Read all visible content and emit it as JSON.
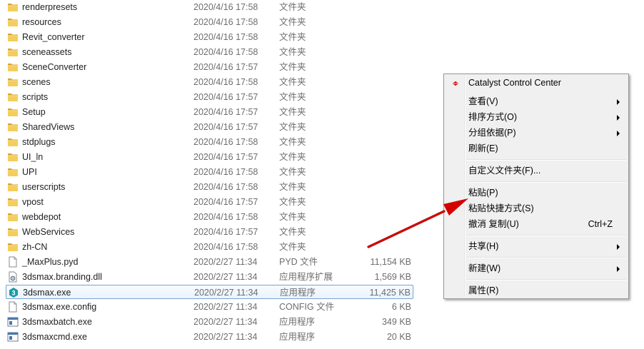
{
  "files": [
    {
      "name": "renderpresets",
      "date": "2020/4/16 17:58",
      "type": "文件夹",
      "size": "",
      "icon": "folder-icon"
    },
    {
      "name": "resources",
      "date": "2020/4/16 17:58",
      "type": "文件夹",
      "size": "",
      "icon": "folder-icon"
    },
    {
      "name": "Revit_converter",
      "date": "2020/4/16 17:58",
      "type": "文件夹",
      "size": "",
      "icon": "folder-icon"
    },
    {
      "name": "sceneassets",
      "date": "2020/4/16 17:58",
      "type": "文件夹",
      "size": "",
      "icon": "folder-icon"
    },
    {
      "name": "SceneConverter",
      "date": "2020/4/16 17:57",
      "type": "文件夹",
      "size": "",
      "icon": "folder-icon"
    },
    {
      "name": "scenes",
      "date": "2020/4/16 17:58",
      "type": "文件夹",
      "size": "",
      "icon": "folder-icon"
    },
    {
      "name": "scripts",
      "date": "2020/4/16 17:57",
      "type": "文件夹",
      "size": "",
      "icon": "folder-icon"
    },
    {
      "name": "Setup",
      "date": "2020/4/16 17:57",
      "type": "文件夹",
      "size": "",
      "icon": "folder-icon"
    },
    {
      "name": "SharedViews",
      "date": "2020/4/16 17:57",
      "type": "文件夹",
      "size": "",
      "icon": "folder-icon"
    },
    {
      "name": "stdplugs",
      "date": "2020/4/16 17:58",
      "type": "文件夹",
      "size": "",
      "icon": "folder-icon"
    },
    {
      "name": "UI_ln",
      "date": "2020/4/16 17:57",
      "type": "文件夹",
      "size": "",
      "icon": "folder-icon"
    },
    {
      "name": "UPI",
      "date": "2020/4/16 17:58",
      "type": "文件夹",
      "size": "",
      "icon": "folder-icon"
    },
    {
      "name": "userscripts",
      "date": "2020/4/16 17:58",
      "type": "文件夹",
      "size": "",
      "icon": "folder-icon"
    },
    {
      "name": "vpost",
      "date": "2020/4/16 17:57",
      "type": "文件夹",
      "size": "",
      "icon": "folder-icon"
    },
    {
      "name": "webdepot",
      "date": "2020/4/16 17:58",
      "type": "文件夹",
      "size": "",
      "icon": "folder-icon"
    },
    {
      "name": "WebServices",
      "date": "2020/4/16 17:57",
      "type": "文件夹",
      "size": "",
      "icon": "folder-icon"
    },
    {
      "name": "zh-CN",
      "date": "2020/4/16 17:58",
      "type": "文件夹",
      "size": "",
      "icon": "folder-icon"
    },
    {
      "name": "_MaxPlus.pyd",
      "date": "2020/2/27 11:34",
      "type": "PYD 文件",
      "size": "11,154 KB",
      "icon": "document-icon"
    },
    {
      "name": "3dsmax.branding.dll",
      "date": "2020/2/27 11:34",
      "type": "应用程序扩展",
      "size": "1,569 KB",
      "icon": "dll-gear-icon"
    },
    {
      "name": "3dsmax.exe",
      "date": "2020/2/27 11:34",
      "type": "应用程序",
      "size": "11,425 KB",
      "icon": "3dsmax-app-icon",
      "selected": true
    },
    {
      "name": "3dsmax.exe.config",
      "date": "2020/2/27 11:34",
      "type": "CONFIG 文件",
      "size": "6 KB",
      "icon": "document-icon"
    },
    {
      "name": "3dsmaxbatch.exe",
      "date": "2020/2/27 11:34",
      "type": "应用程序",
      "size": "349 KB",
      "icon": "console-app-icon"
    },
    {
      "name": "3dsmaxcmd.exe",
      "date": "2020/2/27 11:34",
      "type": "应用程序",
      "size": "20 KB",
      "icon": "console-app-icon"
    }
  ],
  "context_menu": {
    "items": [
      {
        "label": "Catalyst Control Center",
        "icon": "catalyst-icon"
      },
      {
        "label": "查看(V)",
        "submenu": true
      },
      {
        "label": "排序方式(O)",
        "submenu": true
      },
      {
        "label": "分组依据(P)",
        "submenu": true
      },
      {
        "label": "刷新(E)"
      },
      {
        "separator": true
      },
      {
        "label": "自定义文件夹(F)..."
      },
      {
        "separator": true
      },
      {
        "label": "粘贴(P)"
      },
      {
        "label": "粘贴快捷方式(S)"
      },
      {
        "label": "撤消 复制(U)",
        "shortcut": "Ctrl+Z"
      },
      {
        "separator": true
      },
      {
        "label": "共享(H)",
        "submenu": true
      },
      {
        "separator": true
      },
      {
        "label": "新建(W)",
        "submenu": true
      },
      {
        "separator": true
      },
      {
        "label": "属性(R)"
      }
    ]
  },
  "colors": {
    "folder": "#e8b93c",
    "selection_border": "#7da2ce",
    "arrow": "#d40000",
    "menu_bg": "#f0f0f0"
  }
}
